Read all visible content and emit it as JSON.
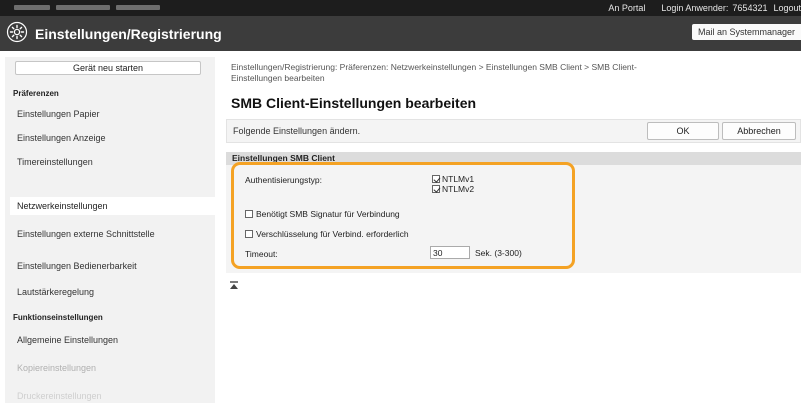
{
  "topbar": {
    "portal_link": "An Portal",
    "login_user_label": "Login Anwender:",
    "login_user_id": "7654321",
    "logout_link": "Logout"
  },
  "titlebar": {
    "title": "Einstellungen/Registrierung",
    "mail_link": "Mail an Systemmanager"
  },
  "sidebar": {
    "restart_button": "Gerät neu starten",
    "section_preferences": "Präferenzen",
    "section_function": "Funktionseinstellungen",
    "items": [
      "Einstellungen Papier",
      "Einstellungen Anzeige",
      "Timereinstellungen",
      "Netzwerkeinstellungen",
      "Einstellungen externe Schnittstelle",
      "Einstellungen Bedienerbarkeit",
      "Lautstärkeregelung",
      "Allgemeine Einstellungen",
      "Kopiereinstellungen",
      "Druckereinstellungen"
    ],
    "active_item": "Netzwerkeinstellungen"
  },
  "main": {
    "breadcrumb_line1": "Einstellungen/Registrierung: Präferenzen: Netzwerkeinstellungen > Einstellungen SMB Client > SMB Client-",
    "breadcrumb_line2": "Einstellungen bearbeiten",
    "page_title": "SMB Client-Einstellungen bearbeiten",
    "instruction": "Folgende Einstellungen ändern.",
    "ok_button": "OK",
    "cancel_button": "Abbrechen",
    "section_title": "Einstellungen SMB Client",
    "auth_type_label": "Authentisierungstyp:",
    "ntlmv1_label": "NTLMv1",
    "ntlmv1_checked": true,
    "ntlmv2_label": "NTLMv2",
    "ntlmv2_checked": true,
    "require_signature_label": "Benötigt SMB Signatur für Verbindung",
    "require_signature_checked": false,
    "require_encryption_label": "Verschlüsselung für Verbind. erforderlich",
    "require_encryption_checked": false,
    "timeout_label": "Timeout:",
    "timeout_value": "30",
    "timeout_unit": "Sek. (3-300)"
  },
  "colors": {
    "highlight": "#f4a224",
    "topbar": "#1d1d1d",
    "titlebar": "#3c3c3c"
  },
  "icons": {
    "title_icon": "settings-gear-icon",
    "scroll_top_icon": "scroll-to-top-icon"
  }
}
